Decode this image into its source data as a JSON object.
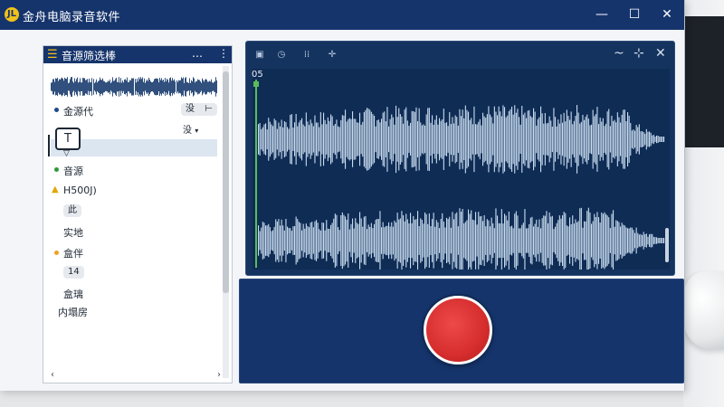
{
  "titlebar": {
    "logo": "JL",
    "title": "金舟电脑录音软件",
    "minimize": "—",
    "maximize": "☐",
    "close": "✕"
  },
  "left_panel": {
    "title": "音源筛选棒",
    "header_buttons": [
      "…",
      "⋮"
    ],
    "rows": [
      {
        "label": "金源代",
        "dot_color": "#1e4a8a"
      },
      {
        "label": "音源",
        "dot_color": "#2d9a3a"
      },
      {
        "label": "H500J)",
        "dot_color": "#f2c21b"
      },
      {
        "label": "实地",
        "dot_color": null
      },
      {
        "label": "盒伴",
        "dot_color": "#f0a02a"
      },
      {
        "label": "盒璃",
        "dot_color": null
      },
      {
        "label": "内塌房",
        "dot_color": null
      }
    ],
    "pill_top": [
      "没",
      "⊢"
    ],
    "dropdown_label": "没",
    "t_button": "T",
    "pills": [
      "此",
      "14"
    ],
    "footer_buttons": [
      "‹",
      "›"
    ]
  },
  "wave_panel": {
    "toolbar_icons": [
      "window-icon",
      "clock-icon",
      "grid-icon",
      "crosshair-icon"
    ],
    "controls": [
      "~",
      "⊹",
      "✕"
    ],
    "track_label": "05"
  },
  "record": {
    "button_icon": "record-icon"
  },
  "colors": {
    "brand_navy": "#16346c",
    "record_red": "#d62d2d",
    "waveform": "#c9dcef",
    "accent_yellow": "#f2c21b"
  }
}
